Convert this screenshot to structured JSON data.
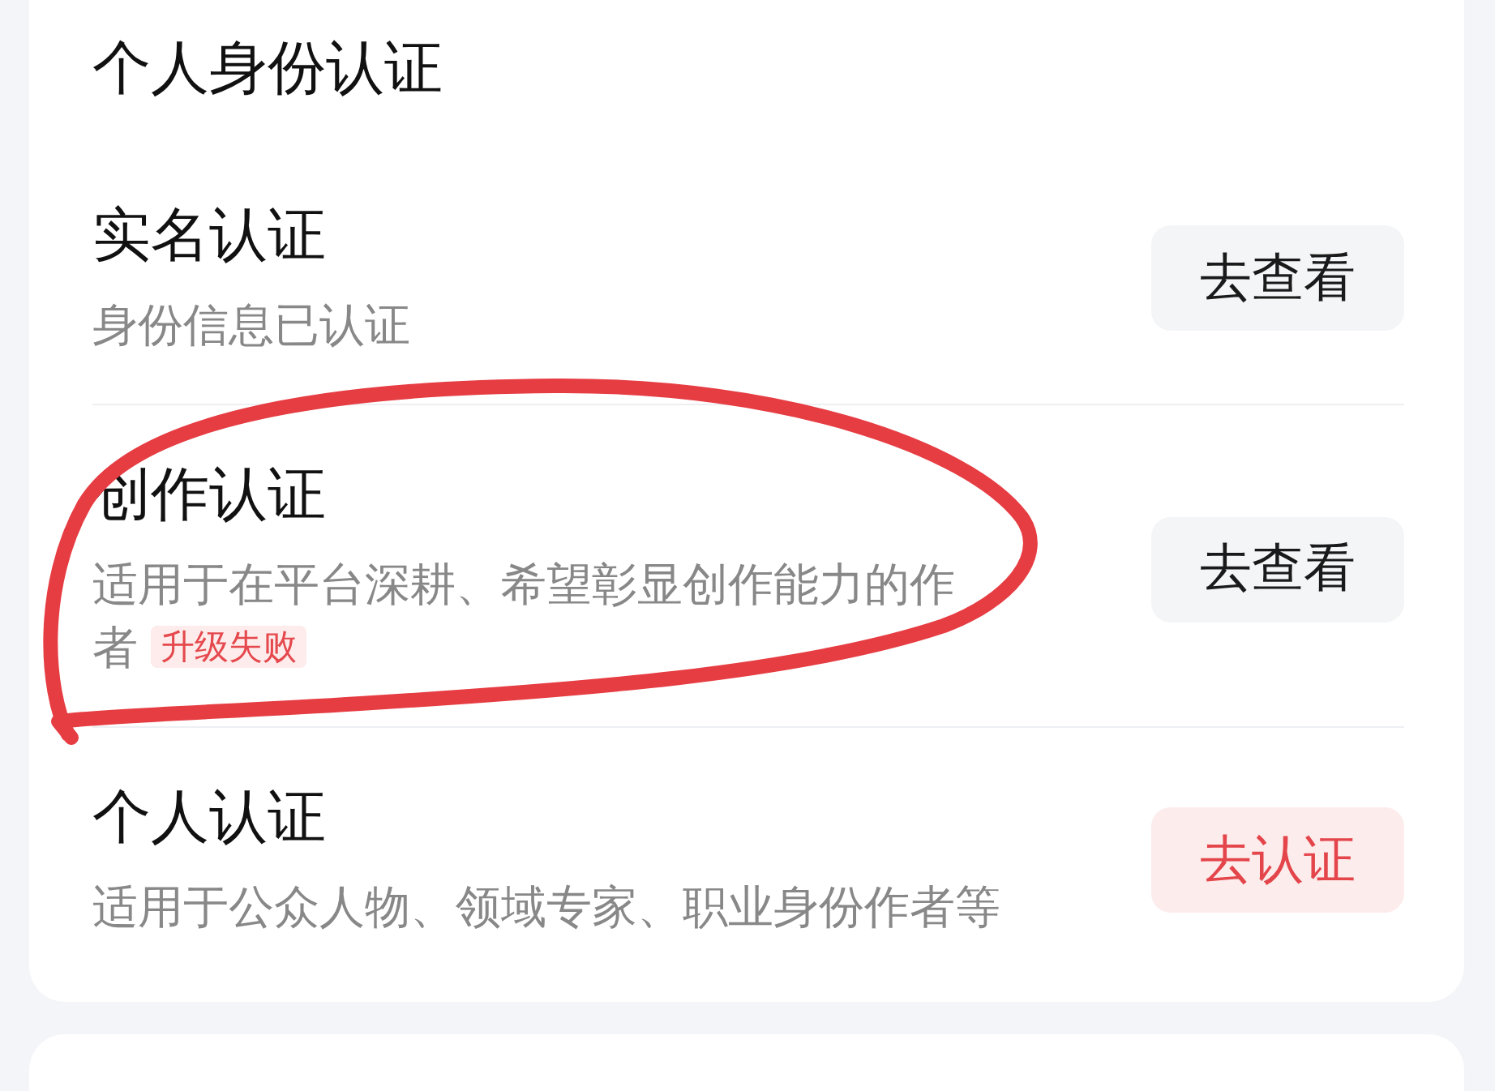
{
  "section": {
    "title": "个人身份认证",
    "items": [
      {
        "title": "实名认证",
        "description": "身份信息已认证",
        "button": {
          "label": "去查看",
          "highlighted": false
        },
        "circled": false
      },
      {
        "title": "创作认证",
        "description": "适用于在平台深耕、希望彰显创作能力的作者",
        "badge": "升级失败",
        "button": {
          "label": "去查看",
          "highlighted": false
        },
        "circled": true
      },
      {
        "title": "个人认证",
        "description": "适用于公众人物、领域专家、职业身份作者等",
        "button": {
          "label": "去认证",
          "highlighted": true
        },
        "circled": false
      }
    ]
  }
}
